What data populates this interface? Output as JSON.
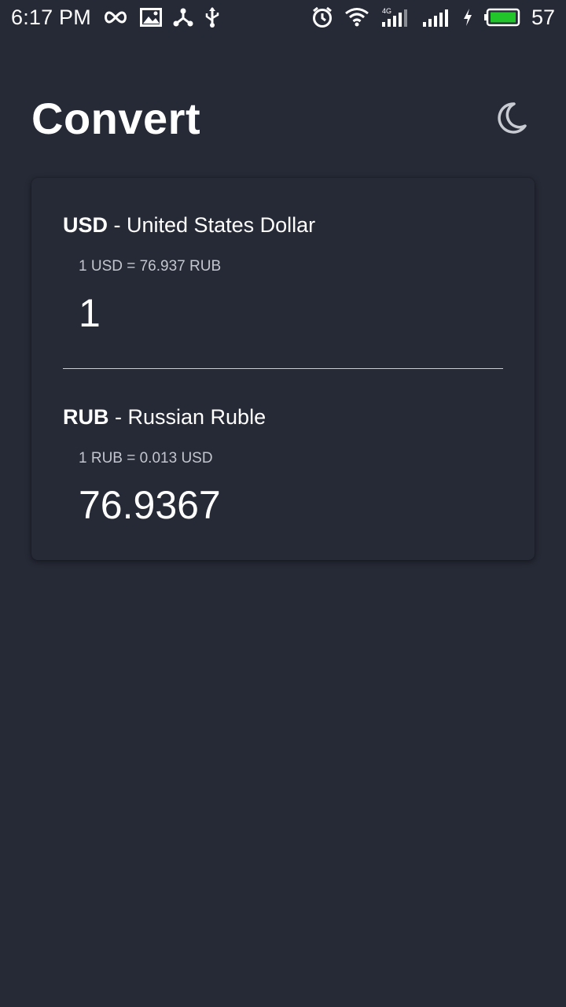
{
  "status_bar": {
    "time": "6:17 PM",
    "battery": "57",
    "network_label": "4G",
    "left_icons": [
      "infinity-icon",
      "image-icon",
      "share-hub-icon",
      "usb-icon"
    ],
    "right_icons": [
      "alarm-icon",
      "wifi-icon",
      "signal-4g-icon",
      "signal-icon",
      "charging-icon",
      "battery-icon"
    ],
    "battery_color": "#22c62a"
  },
  "header": {
    "title": "Convert",
    "theme_icon": "moon-icon"
  },
  "converter": {
    "from": {
      "code": "USD",
      "name": " - United States Dollar",
      "rate": "1 USD = 76.937 RUB",
      "amount": "1"
    },
    "to": {
      "code": "RUB",
      "name": " - Russian Ruble",
      "rate": "1 RUB = 0.013 USD",
      "amount": "76.9367"
    }
  },
  "colors": {
    "background": "#262a36",
    "text": "#ffffff",
    "muted_text": "#c3c6cd",
    "divider": "#c9ccd2"
  }
}
